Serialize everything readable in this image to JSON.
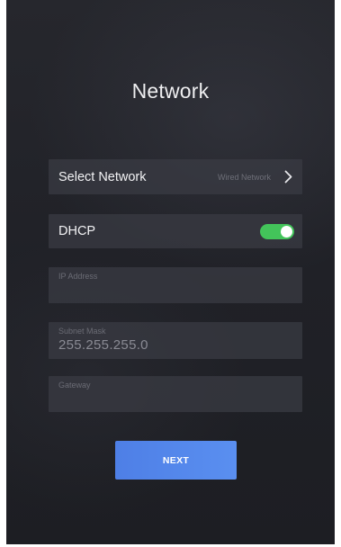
{
  "header": {
    "title": "Network"
  },
  "select_network": {
    "label": "Select Network",
    "value": "Wired Network",
    "icon": "chevron-right-icon"
  },
  "dhcp": {
    "label": "DHCP",
    "enabled": true,
    "toggle_color": "#43c45a"
  },
  "fields": {
    "ip_address": {
      "label": "IP Address",
      "value": ""
    },
    "subnet_mask": {
      "label": "Subnet Mask",
      "value": "255.255.255.0"
    },
    "gateway": {
      "label": "Gateway",
      "value": ""
    }
  },
  "actions": {
    "next_label": "NEXT",
    "next_color": "#5585ec"
  }
}
